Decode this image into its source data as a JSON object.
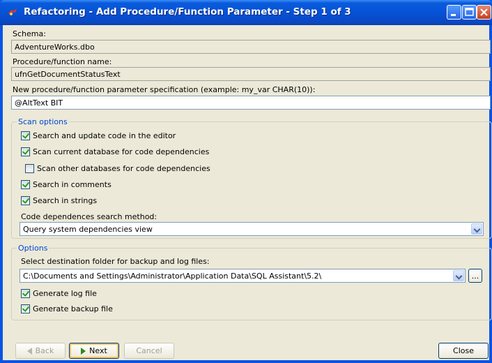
{
  "window": {
    "title": "Refactoring - Add Procedure/Function Parameter - Step 1 of 3"
  },
  "schema": {
    "label": "Schema:",
    "value": "AdventureWorks.dbo"
  },
  "procedure": {
    "label": "Procedure/function name:",
    "value": "ufnGetDocumentStatusText"
  },
  "parameter": {
    "label": "New procedure/function parameter specification (example: my_var CHAR(10)):",
    "value": "@AltText BIT"
  },
  "scan_options": {
    "title": "Scan options",
    "search_update_editor": {
      "label": "Search and update code in the editor",
      "checked": true
    },
    "scan_current_db": {
      "label": "Scan current database for code dependencies",
      "checked": true
    },
    "scan_other_dbs": {
      "label": "Scan other databases for code dependencies",
      "checked": false
    },
    "search_comments": {
      "label": "Search in comments",
      "checked": true
    },
    "search_strings": {
      "label": "Search in strings",
      "checked": true
    },
    "method_label": "Code dependences search method:",
    "method_value": "Query system dependencies view"
  },
  "options": {
    "title": "Options",
    "folder_label": "Select destination folder for backup and log files:",
    "folder_value": "C:\\Documents and Settings\\Administrator\\Application Data\\SQL Assistant\\5.2\\",
    "browse_label": "...",
    "generate_log": {
      "label": "Generate log file",
      "checked": true
    },
    "generate_backup": {
      "label": "Generate backup file",
      "checked": true
    }
  },
  "buttons": {
    "back": "Back",
    "next": "Next",
    "cancel": "Cancel",
    "close": "Close"
  }
}
